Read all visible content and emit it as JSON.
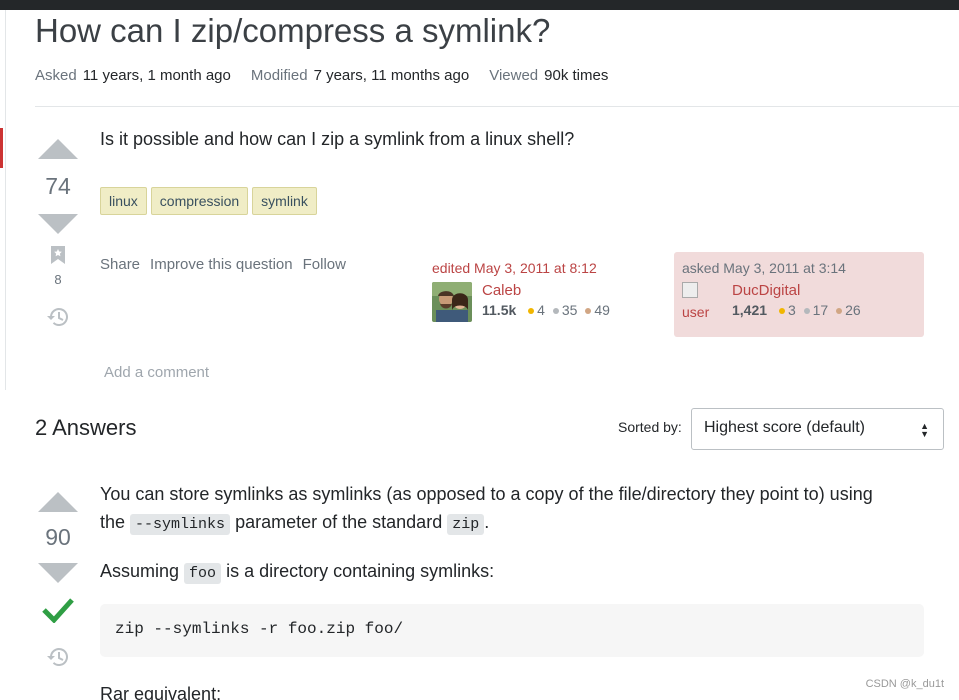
{
  "question": {
    "title": "How can I zip/compress a symlink?",
    "meta": [
      {
        "key": "Asked",
        "value": "11 years, 1 month ago"
      },
      {
        "key": "Modified",
        "value": "7 years, 11 months ago"
      },
      {
        "key": "Viewed",
        "value": "90k times"
      }
    ],
    "votes": "74",
    "bookmarks": "8",
    "body": "Is it possible and how can I zip a symlink from a linux shell?",
    "tags": [
      "linux",
      "compression",
      "symlink"
    ],
    "menu": [
      "Share",
      "Improve this question",
      "Follow"
    ],
    "editor": {
      "action": "edited May 3, 2011 at 8:12",
      "name": "Caleb",
      "rep": "11.5k",
      "gold": "4",
      "silver": "35",
      "bronze": "49"
    },
    "owner": {
      "action": "asked May 3, 2011 at 3:14",
      "avatar_alt": "user",
      "name": "DucDigital",
      "rep": "1,421",
      "gold": "3",
      "silver": "17",
      "bronze": "26"
    },
    "add_comment": "Add a comment"
  },
  "answers": {
    "header": "2 Answers",
    "sort_label": "Sorted by:",
    "sort_value": "Highest score (default)",
    "first": {
      "votes": "90",
      "p1_a": "You can store symlinks as symlinks (as opposed to a copy of the file/directory they point to) using",
      "p1_b": "the",
      "p1_code1": "--symlinks",
      "p1_c": "parameter of the standard",
      "p1_code2": "zip",
      "p1_d": ".",
      "p2_a": "Assuming",
      "p2_code": "foo",
      "p2_b": "is a directory containing symlinks:",
      "code": "zip --symlinks -r foo.zip foo/",
      "p3": "Rar equivalent:"
    }
  },
  "watermark": "CSDN @k_du1t",
  "colors": {
    "tag_bg": "#f0edc6",
    "accent_red": "#b44",
    "accepted_green": "#2f9e44",
    "owner_card": "#f1dbdb"
  }
}
